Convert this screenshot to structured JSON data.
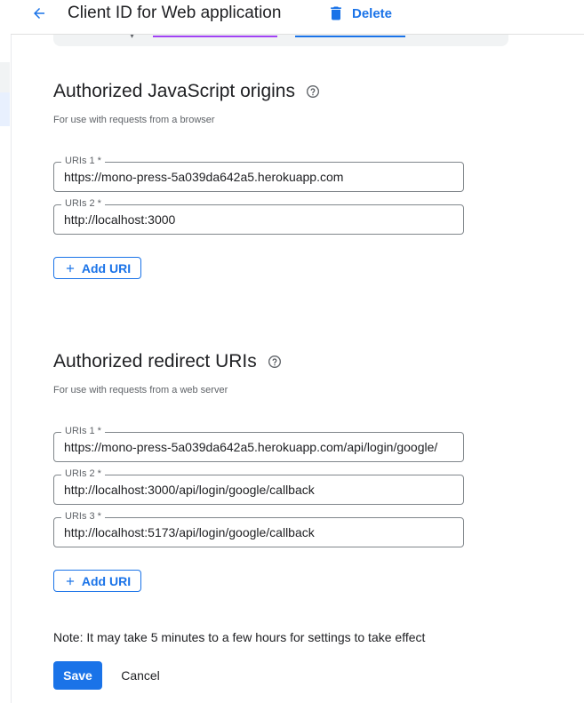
{
  "header": {
    "title": "Client ID for Web application",
    "delete_label": "Delete",
    "back_icon": "arrow-back-icon",
    "delete_icon": "trash-icon"
  },
  "colors": {
    "accent": "#1a73e8",
    "text": "#202124",
    "muted": "#5f6368",
    "border": "#80868b"
  },
  "js_origins": {
    "title": "Authorized JavaScript origins",
    "subtitle": "For use with requests from a browser",
    "fields": [
      {
        "label": "URIs 1 *",
        "value": "https://mono-press-5a039da642a5.herokuapp.com"
      },
      {
        "label": "URIs 2 *",
        "value": "http://localhost:3000"
      }
    ],
    "add_label": "Add URI"
  },
  "redirect_uris": {
    "title": "Authorized redirect URIs",
    "subtitle": "For use with requests from a web server",
    "fields": [
      {
        "label": "URIs 1 *",
        "value": "https://mono-press-5a039da642a5.herokuapp.com/api/login/google/"
      },
      {
        "label": "URIs 2 *",
        "value": "http://localhost:3000/api/login/google/callback"
      },
      {
        "label": "URIs 3 *",
        "value": "http://localhost:5173/api/login/google/callback"
      }
    ],
    "add_label": "Add URI"
  },
  "footer": {
    "note": "Note: It may take 5 minutes to a few hours for settings to take effect",
    "save_label": "Save",
    "cancel_label": "Cancel"
  }
}
